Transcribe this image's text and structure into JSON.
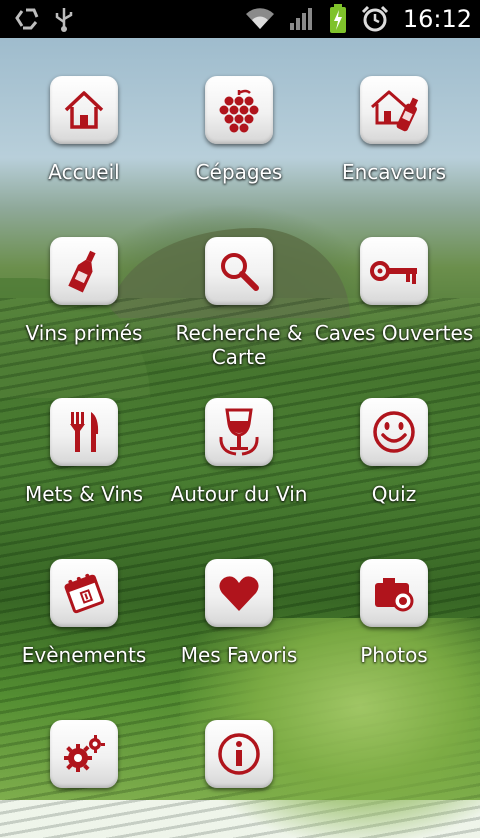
{
  "status_bar": {
    "time": "16:12",
    "icons": [
      "recycle-icon",
      "usb-icon",
      "wifi-icon",
      "signal-icon",
      "battery-charging-icon",
      "alarm-icon"
    ]
  },
  "accent_color": "#b0141c",
  "menu": {
    "items": [
      {
        "label": "Accueil",
        "icon": "home-icon"
      },
      {
        "label": "Cépages",
        "icon": "grapes-icon"
      },
      {
        "label": "Encaveurs",
        "icon": "house-bottle-icon"
      },
      {
        "label": "Vins primés",
        "icon": "bottle-icon"
      },
      {
        "label": "Recherche &\nCarte",
        "icon": "magnifier-icon"
      },
      {
        "label": "Caves Ouvertes",
        "icon": "key-icon"
      },
      {
        "label": "Mets & Vins",
        "icon": "fork-knife-icon"
      },
      {
        "label": "Autour du Vin",
        "icon": "wine-glass-icon"
      },
      {
        "label": "Quiz",
        "icon": "smiley-icon"
      },
      {
        "label": "Evènements",
        "icon": "calendar-icon"
      },
      {
        "label": "Mes Favoris",
        "icon": "heart-icon"
      },
      {
        "label": "Photos",
        "icon": "camera-icon"
      },
      {
        "label": "",
        "icon": "gears-icon"
      },
      {
        "label": "",
        "icon": "info-icon"
      }
    ]
  }
}
